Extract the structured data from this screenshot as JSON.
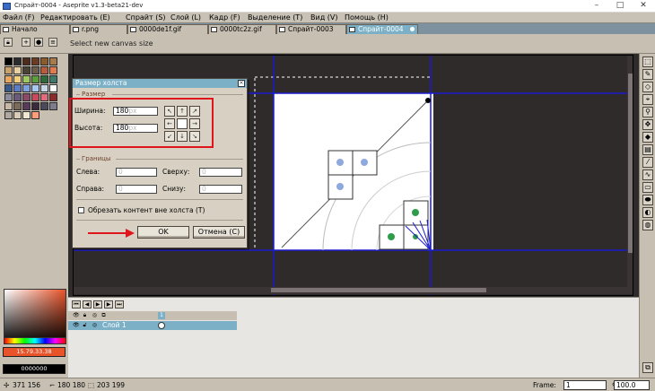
{
  "window": {
    "title": "Спрайт-0004 - Aseprite v1.3-beta21-dev"
  },
  "menu": [
    "Файл (F)",
    "Редактировать (E)",
    "Спрайт (S)",
    "Слой (L)",
    "Кадр (F)",
    "Выделение (T)",
    "Вид (V)",
    "Помощь (H)"
  ],
  "tabs": [
    {
      "label": "Начало",
      "active": false
    },
    {
      "label": "r.png",
      "active": false
    },
    {
      "label": "0000de1f.gif",
      "active": false
    },
    {
      "label": "0000tc2z.gif",
      "active": false
    },
    {
      "label": "Спрайт-0003",
      "active": false
    },
    {
      "label": "Спрайт-0004",
      "active": true
    }
  ],
  "context": {
    "hint": "Select new canvas size"
  },
  "dialog": {
    "title": "Размер холста",
    "size_group": "Размер",
    "width_label": "Ширина:",
    "width_value": "180",
    "width_suffix": "px",
    "height_label": "Высота:",
    "height_value": "180",
    "height_suffix": "px",
    "borders_group": "Границы",
    "left_label": "Слева:",
    "left_value": "0",
    "top_label": "Сверху:",
    "top_value": "0",
    "right_label": "Справа:",
    "right_value": "0",
    "bottom_label": "Снизу:",
    "bottom_value": "0",
    "crop_label": "Обрезать контент вне холста",
    "crop_key": "(T)",
    "ok": "OK",
    "cancel": "Отмена (C)",
    "close_glyph": "×"
  },
  "colors": {
    "fg_label": "15.79.33.38",
    "bg_label": "0000000",
    "fg": "#e8532a",
    "bg": "#000000"
  },
  "timeline": {
    "layer_name": "Слой 1",
    "frame_number": "1"
  },
  "status": {
    "pos": "371 156",
    "size": "180 180",
    "sel": "203 199",
    "frame_label": "Frame:",
    "frame_value": "1",
    "zoom_value": "100.0"
  },
  "palette": [
    "#000000",
    "#2b2b2b",
    "#4e2b1c",
    "#6b3b22",
    "#8c5a2b",
    "#a87b4c",
    "#c9a16b",
    "#e6cfa0",
    "#4a4236",
    "#6b5e4c",
    "#b85a3c",
    "#e07b50",
    "#e8a860",
    "#f0d080",
    "#9ec860",
    "#5c9e3c",
    "#2f6b3a",
    "#3d7a6b",
    "#3b5a8c",
    "#5c7ec8",
    "#7ca0e0",
    "#a8c8f0",
    "#c8d8e8",
    "#ffffff",
    "#8c8c9c",
    "#6b5a7c",
    "#8c4a6b",
    "#c84a5c",
    "#e06b7c",
    "#8c2b2b",
    "#c8b8a8",
    "#7c6b5a",
    "#5a3a5a",
    "#3a2a3a",
    "#4a4a5a",
    "#7c7c8c",
    "#b0a8a0",
    "#d8ccb8",
    "#f0e8d0",
    "#ff9c7c"
  ]
}
